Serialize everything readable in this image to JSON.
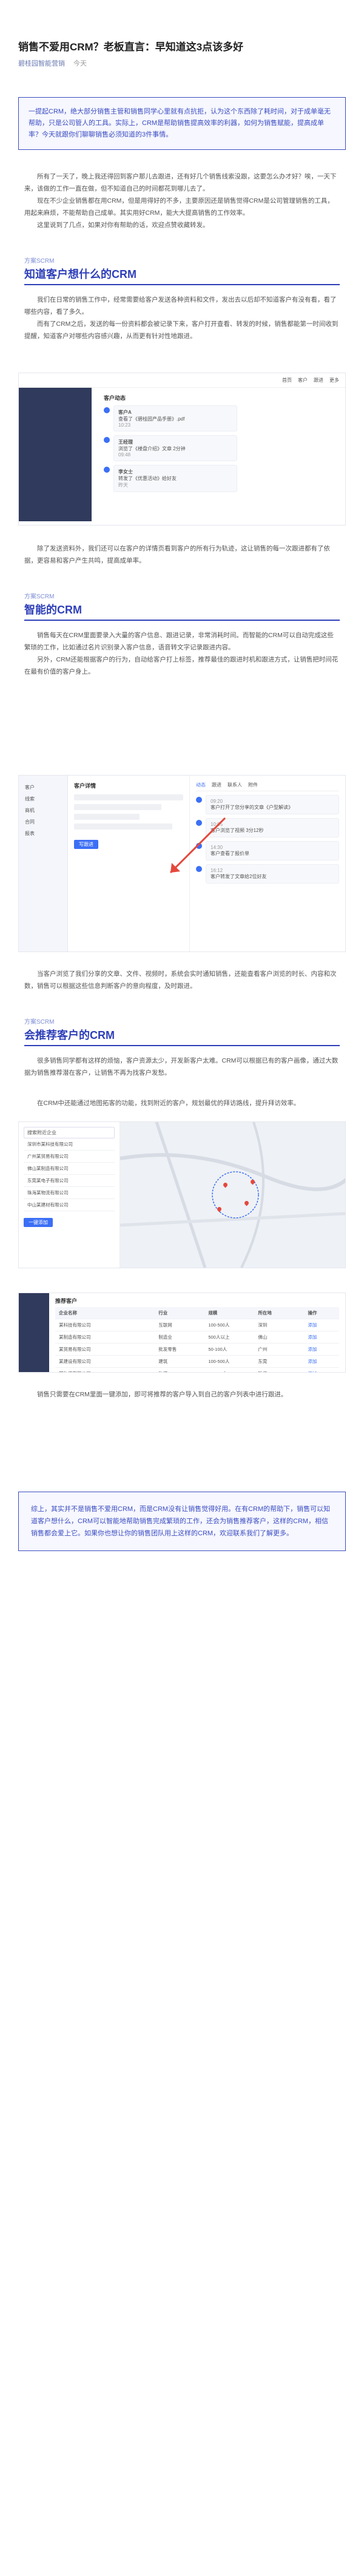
{
  "article": {
    "title": "销售不爱用CRM？老板直言：早知道这3点该多好",
    "author": "碧桂园智能营销",
    "time": "今天",
    "intro": "一提起CRM，绝大部分销售主管和销售同学心里就有点抗拒，认为这个东西除了耗时间，对于成单毫无帮助，只是公司管人的工具。实际上，CRM是帮助销售提高效率的利器，如何为销售赋能，提高成单率？今天就跟你们聊聊销售必须知道的3件事情。",
    "p1": "所有了一天了，晚上我还得回到客户那儿去跟进，还有好几个销售线索没跟，这要怎么办才好？唉，一天下来，该做的工作一直在做，但不知道自己的时间都花到哪儿去了。",
    "p2": "现在不少企业销售都在用CRM，但是用得好的不多，主要原因还是销售觉得CRM是公司管理销售的工具，用起来麻烦，不能帮助自己成单。其实用好CRM，能大大提高销售的工作效率。",
    "p3": "这里说到了几点，如果对你有帮助的话，欢迎点赞收藏转发。"
  },
  "sections": [
    {
      "small": "方案SCRM",
      "big": "知道客户想什么的CRM",
      "paras": [
        "我们在日常的销售工作中，经常需要给客户发送各种资料和文件，发出去以后却不知道客户有没有看，看了哪些内容，看了多久。",
        "而有了CRM之后，发送的每一份资料都会被记录下来，客户打开查看、转发的时候，销售都能第一时间收到提醒，知道客户对哪些内容感兴趣，从而更有针对性地跟进。"
      ],
      "after": "除了发送资料外，我们还可以在客户的详情页看到客户的所有行为轨迹，这让销售的每一次跟进都有了依据，更容易和客户产生共鸣，提高成单率。"
    },
    {
      "small": "方案SCRM",
      "big": "智能的CRM",
      "paras": [
        "销售每天在CRM里面要录入大量的客户信息、跟进记录，非常消耗时间。而智能的CRM可以自动完成这些繁琐的工作，比如通过名片识别录入客户信息，语音转文字记录跟进内容。",
        "另外，CRM还能根据客户的行为，自动给客户打上标签，推荐最佳的跟进时机和跟进方式，让销售把时间花在最有价值的客户身上。"
      ],
      "after": "当客户浏览了我们分享的文章、文件、视频时，系统会实时通知销售，还能查看客户浏览的时长、内容和次数，销售可以根据这些信息判断客户的意向程度，及时跟进。"
    },
    {
      "small": "方案SCRM",
      "big": "会推荐客户的CRM",
      "paras": [
        "很多销售同学都有这样的烦恼，客户资源太少，开发新客户太难。CRM可以根据已有的客户画像，通过大数据为销售推荐潜在客户，让销售不再为找客户发愁。",
        "在CRM中还能通过地图拓客的功能，找到附近的客户，规划最优的拜访路线，提升拜访效率。"
      ],
      "after": "销售只需要在CRM里面一键添加，即可将推荐的客户导入到自己的客户列表中进行跟进。"
    }
  ],
  "outro": "综上，其实并不是销售不爱用CRM，而是CRM没有让销售觉得好用。在有CRM的帮助下，销售可以知道客户想什么，CRM可以智能地帮助销售完成繁琐的工作，还会为销售推荐客户，这样的CRM，相信销售都会爱上它。如果你也想让你的销售团队用上这样的CRM，欢迎联系我们了解更多。",
  "shot1": {
    "tabs": [
      "首页",
      "客户",
      "跟进",
      "更多"
    ],
    "title": "客户动态",
    "items": [
      {
        "name": "客户A",
        "text": "查看了《碧桂园产品手册》.pdf",
        "time": "10:23"
      },
      {
        "name": "王经理",
        "text": "浏览了《楼盘介绍》文章 2分钟",
        "time": "09:48"
      },
      {
        "name": "李女士",
        "text": "转发了《优惠活动》给好友",
        "time": "昨天"
      }
    ]
  },
  "shot2": {
    "side": [
      "客户",
      "线索",
      "商机",
      "合同",
      "报表"
    ],
    "head": "客户详情",
    "tabs": [
      "动态",
      "跟进",
      "联系人",
      "附件"
    ],
    "timeline": [
      {
        "t": "09:20",
        "text": "客户打开了您分享的文章《户型解读》"
      },
      {
        "t": "10:05",
        "text": "客户浏览了视频 3分12秒"
      },
      {
        "t": "14:30",
        "text": "客户查看了报价单"
      },
      {
        "t": "16:12",
        "text": "客户转发了文章给2位好友"
      }
    ],
    "btn": "写跟进"
  },
  "shot3": {
    "search": "搜索附近企业",
    "list": [
      "深圳市某科技有限公司",
      "广州某贸易有限公司",
      "佛山某制造有限公司",
      "东莞某电子有限公司",
      "珠海某物流有限公司",
      "中山某建材有限公司"
    ],
    "btn": "一键添加"
  },
  "shot4": {
    "head": "推荐客户",
    "cols": [
      "企业名称",
      "行业",
      "规模",
      "所在地",
      "操作"
    ],
    "rows": [
      [
        "某科技有限公司",
        "互联网",
        "100-500人",
        "深圳",
        "添加"
      ],
      [
        "某制造有限公司",
        "制造业",
        "500人以上",
        "佛山",
        "添加"
      ],
      [
        "某贸易有限公司",
        "批发零售",
        "50-100人",
        "广州",
        "添加"
      ],
      [
        "某建设有限公司",
        "建筑",
        "100-500人",
        "东莞",
        "添加"
      ],
      [
        "某物流有限公司",
        "物流",
        "50-100人",
        "珠海",
        "添加"
      ]
    ]
  },
  "colors": {
    "accent": "#2e3fb8",
    "link": "#3b6ff5",
    "pin": "#e5483c"
  }
}
